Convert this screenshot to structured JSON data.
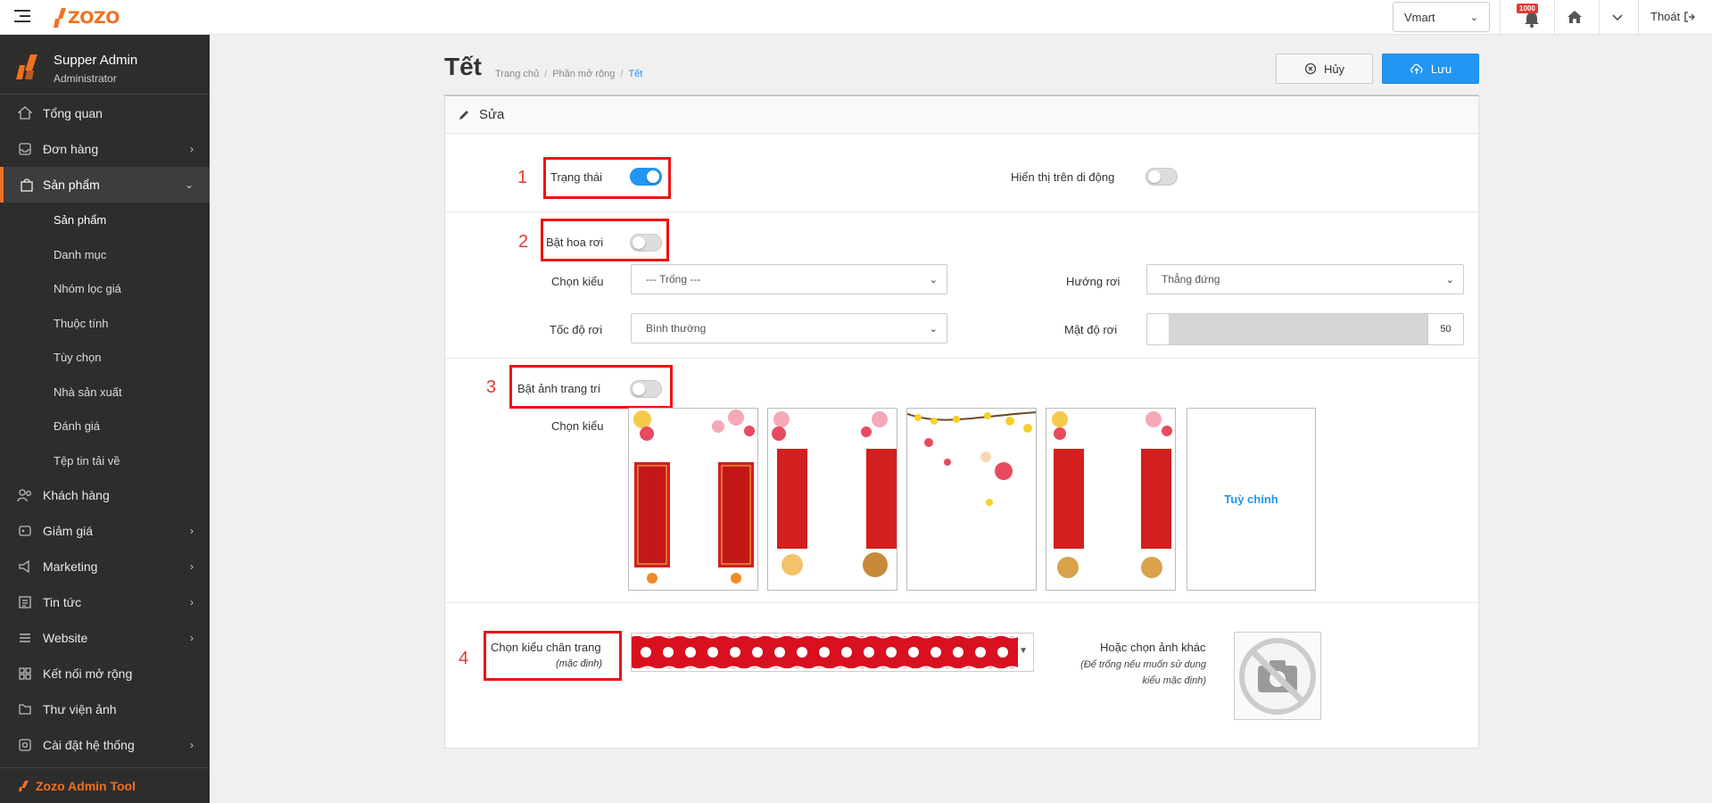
{
  "app": {
    "logo_text": "ZOZO",
    "store_select": "Vmart",
    "notification_badge": "1000",
    "logout_label": "Thoát"
  },
  "user": {
    "name": "Supper Admin",
    "role": "Administrator"
  },
  "sidebar": {
    "items": [
      {
        "label": "Tổng quan",
        "icon": "home-icon"
      },
      {
        "label": "Đơn hàng",
        "icon": "inbox-icon"
      },
      {
        "label": "Sản phẩm",
        "icon": "bag-icon"
      },
      {
        "label": "Khách hàng",
        "icon": "users-icon"
      },
      {
        "label": "Giảm giá",
        "icon": "tag-icon"
      },
      {
        "label": "Marketing",
        "icon": "megaphone-icon"
      },
      {
        "label": "Tin tức",
        "icon": "news-icon"
      },
      {
        "label": "Website",
        "icon": "menu-icon"
      },
      {
        "label": "Kết nối mở rộng",
        "icon": "grid-icon"
      },
      {
        "label": "Thư viện ảnh",
        "icon": "folder-icon"
      },
      {
        "label": "Cài đặt hệ thống",
        "icon": "settings-icon"
      }
    ],
    "sub_items": [
      "Sản phẩm",
      "Danh mục",
      "Nhóm lọc giá",
      "Thuộc tính",
      "Tùy chọn",
      "Nhà sản xuất",
      "Đánh giá",
      "Tệp tin tải về"
    ],
    "tool_label": "Zozo Admin Tool"
  },
  "page": {
    "title": "Tết",
    "breadcrumb": [
      "Trang chủ",
      "Phần mở rộng",
      "Tết"
    ],
    "cancel_label": "Hủy",
    "save_label": "Lưu",
    "panel_title": "Sửa"
  },
  "form": {
    "status_label": "Trạng thái",
    "status_on": true,
    "mobile_label": "Hiển thị trên di động",
    "mobile_on": false,
    "flower_label": "Bật hoa rơi",
    "flower_on": false,
    "style_label": "Chọn kiểu",
    "style_value": "--- Trống ---",
    "direction_label": "Hướng rơi",
    "direction_value": "Thẳng đứng",
    "speed_label": "Tốc độ rơi",
    "speed_value": "Bình thường",
    "density_label": "Mật độ rơi",
    "density_value": "50",
    "decor_label": "Bật ảnh trang trí",
    "decor_on": false,
    "decor_style_label": "Chọn kiểu",
    "decor_custom_label": "Tuỳ chỉnh",
    "footer_label": "Chọn kiểu chân trang",
    "footer_sub": "(mặc định)",
    "other_img_label": "Hoặc chọn ảnh khác",
    "other_img_note_1": "(Để trống nếu muốn sử dụng",
    "other_img_note_2": "kiểu mặc định)"
  },
  "annotations": [
    "1",
    "2",
    "3",
    "4"
  ],
  "colors": {
    "accent": "#2196f3",
    "brand": "#f37021",
    "sidebar_bg": "#2d2d2d",
    "annotation": "#e11111"
  }
}
